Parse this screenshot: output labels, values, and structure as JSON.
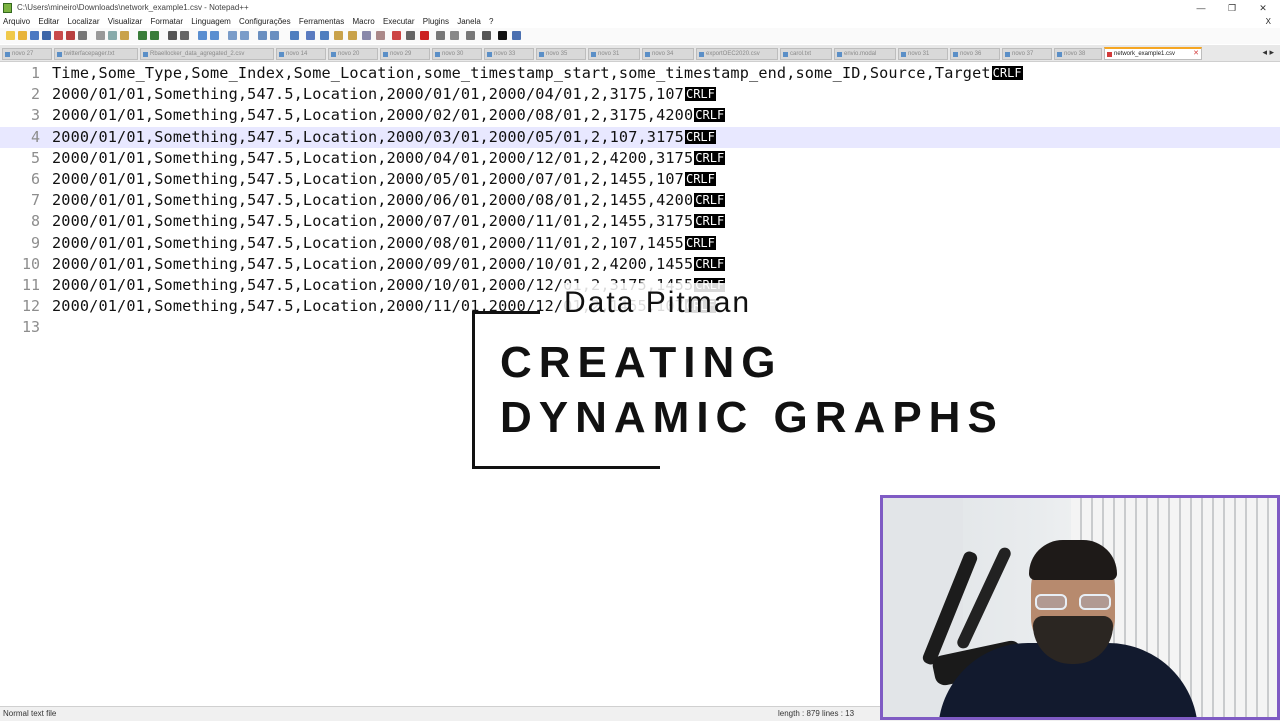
{
  "window": {
    "title": "C:\\Users\\mineiro\\Downloads\\network_example1.csv - Notepad++",
    "controls": [
      "—",
      "❐",
      "✕"
    ]
  },
  "menu": {
    "items": [
      "Arquivo",
      "Editar",
      "Localizar",
      "Visualizar",
      "Formatar",
      "Linguagem",
      "Configurações",
      "Ferramentas",
      "Macro",
      "Executar",
      "Plugins",
      "Janela",
      "?"
    ],
    "close": "X"
  },
  "tabs": {
    "items": [
      "novo 27",
      "twitterfacepager.txt",
      "Rbaellocker_data_agregated_2.csv",
      "novo 14",
      "novo 20",
      "novo 29",
      "novo 30",
      "novo 33",
      "novo 35",
      "novo 31",
      "novo 34",
      "exportOEC2020.csv",
      "carol.txt",
      "envio.modal",
      "novo 31",
      "novo 36",
      "novo 37",
      "novo 38"
    ],
    "active": "network_example1.csv",
    "active_close": "✕",
    "arrows": "◂ ▸"
  },
  "editor": {
    "eol_marker": "CRLF",
    "current_line": 4,
    "lines": [
      {
        "num": "1",
        "text": "Time,Some_Type,Some_Index,Some_Location,some_timestamp_start,some_timestamp_end,some_ID,Source,Target",
        "eol": true
      },
      {
        "num": "2",
        "text": "2000/01/01,Something,547.5,Location,2000/01/01,2000/04/01,2,3175,107",
        "eol": true
      },
      {
        "num": "3",
        "text": "2000/01/01,Something,547.5,Location,2000/02/01,2000/08/01,2,3175,4200",
        "eol": true
      },
      {
        "num": "4",
        "text": "2000/01/01,Something,547.5,Location,2000/03/01,2000/05/01,2,107,3175",
        "eol": true
      },
      {
        "num": "5",
        "text": "2000/01/01,Something,547.5,Location,2000/04/01,2000/12/01,2,4200,3175",
        "eol": true
      },
      {
        "num": "6",
        "text": "2000/01/01,Something,547.5,Location,2000/05/01,2000/07/01,2,1455,107",
        "eol": true
      },
      {
        "num": "7",
        "text": "2000/01/01,Something,547.5,Location,2000/06/01,2000/08/01,2,1455,4200",
        "eol": true
      },
      {
        "num": "8",
        "text": "2000/01/01,Something,547.5,Location,2000/07/01,2000/11/01,2,1455,3175",
        "eol": true
      },
      {
        "num": "9",
        "text": "2000/01/01,Something,547.5,Location,2000/08/01,2000/11/01,2,107,1455",
        "eol": true
      },
      {
        "num": "10",
        "text": "2000/01/01,Something,547.5,Location,2000/09/01,2000/10/01,2,4200,1455",
        "eol": true
      },
      {
        "num": "11",
        "text": "2000/01/01,Something,547.5,Location,2000/10/01,2000/12/01,2,3175,1455",
        "eol": true
      },
      {
        "num": "12",
        "text": "2000/01/01,Something,547.5,Location,2000/11/01,2000/12/01,2,1455,107",
        "eol": true
      },
      {
        "num": "13",
        "text": "",
        "eol": false
      }
    ]
  },
  "overlay": {
    "brand": "Data Pitman",
    "title_line1": "CREATING",
    "title_line2": "DYNAMIC GRAPHS"
  },
  "status": {
    "file_type": "Normal text file",
    "length_lines": "length : 879    lines : 13"
  },
  "colors": {
    "webcam_border": "#7f5bc4",
    "current_line_bg": "#e8e8ff",
    "active_tab_accent": "#f5a623"
  }
}
